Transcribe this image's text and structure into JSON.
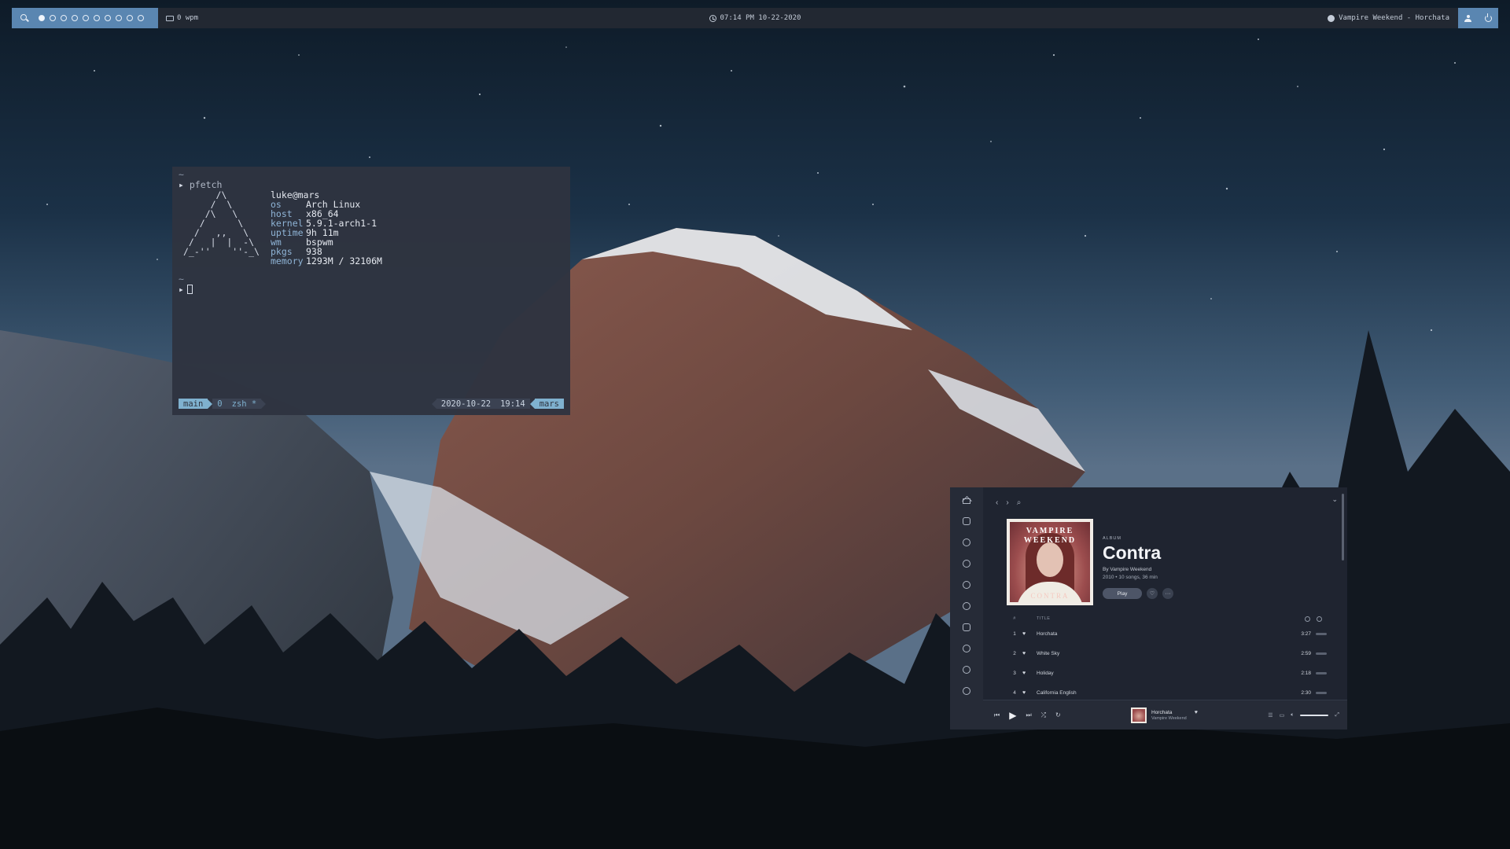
{
  "topbar": {
    "workspaces": [
      true,
      false,
      false,
      false,
      false,
      false,
      false,
      false,
      false,
      false
    ],
    "wpm": "0 wpm",
    "clock": "07:14 PM 10-22-2020",
    "now_playing": "Vampire Weekend - Horchata",
    "accent": "#5a86b1"
  },
  "terminal": {
    "tilde": "~",
    "command": "pfetch",
    "ascii": "      /\\\n     /  \\\n    /\\   \\\n   /      \\\n  /   ,,   \\\n /   |  |  -\\\n/_-''    ''-_\\",
    "user": "luke@mars",
    "info": [
      {
        "key": "os",
        "value": "Arch Linux"
      },
      {
        "key": "host",
        "value": "x86_64"
      },
      {
        "key": "kernel",
        "value": "5.9.1-arch1-1"
      },
      {
        "key": "uptime",
        "value": "9h 11m"
      },
      {
        "key": "wm",
        "value": "bspwm"
      },
      {
        "key": "pkgs",
        "value": "938"
      },
      {
        "key": "memory",
        "value": "1293M / 32106M"
      }
    ],
    "status": {
      "session": "main",
      "window": "0",
      "shell": "zsh *",
      "date": "2020-10-22",
      "time": "19:14",
      "host": "mars"
    },
    "accent": "#7fb1cf"
  },
  "spotify": {
    "cover_artist": "VAMPIRE WEEKEND",
    "cover_title": "CONTRA",
    "kind": "ALBUM",
    "title": "Contra",
    "by": "By Vampire Weekend",
    "stats": "2010 • 10 songs, 36 min",
    "play_label": "Play",
    "col_num": "#",
    "col_title": "TITLE",
    "tracks": [
      {
        "num": "1",
        "title": "Horchata",
        "duration": "3:27"
      },
      {
        "num": "2",
        "title": "White Sky",
        "duration": "2:59"
      },
      {
        "num": "3",
        "title": "Holiday",
        "duration": "2:18"
      },
      {
        "num": "4",
        "title": "California English",
        "duration": "2:30"
      }
    ],
    "player": {
      "title": "Horchata",
      "artist": "Vampire Weekend"
    }
  }
}
